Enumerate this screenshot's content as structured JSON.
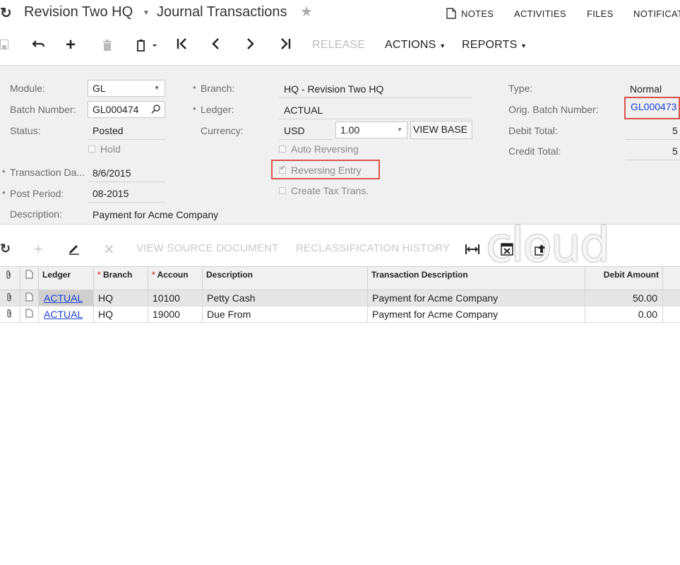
{
  "header": {
    "company": "Revision Two HQ",
    "screen_title": "Journal Transactions",
    "nav": [
      "NOTES",
      "ACTIVITIES",
      "FILES",
      "NOTIFICATIONS"
    ]
  },
  "toolbar": {
    "release": "RELEASE",
    "actions": "ACTIONS",
    "reports": "REPORTS"
  },
  "form": {
    "module_label": "Module:",
    "module_value": "GL",
    "batch_label": "Batch Number:",
    "batch_value": "GL000474",
    "status_label": "Status:",
    "status_value": "Posted",
    "hold_label": "Hold",
    "trans_date_label": "Transaction Da...",
    "trans_date_value": "8/6/2015",
    "post_period_label": "Post Period:",
    "post_period_value": "08-2015",
    "description_label": "Description:",
    "description_value": "Payment for Acme Company",
    "branch_label": "Branch:",
    "branch_value": "HQ - Revision Two HQ",
    "ledger_label": "Ledger:",
    "ledger_value": "ACTUAL",
    "currency_label": "Currency:",
    "currency_value": "USD",
    "rate_value": "1.00",
    "view_base": "VIEW BASE",
    "auto_reversing_label": "Auto Reversing",
    "reversing_entry_label": "Reversing Entry",
    "create_tax_label": "Create Tax Trans.",
    "type_label": "Type:",
    "type_value": "Normal",
    "orig_batch_label": "Orig. Batch Number:",
    "orig_batch_value": "GL000473",
    "debit_total_label": "Debit Total:",
    "debit_total_value": "5",
    "credit_total_label": "Credit Total:",
    "credit_total_value": "5"
  },
  "grid_toolbar": {
    "view_source": "VIEW SOURCE DOCUMENT",
    "reclass_history": "RECLASSIFICATION HISTORY"
  },
  "grid": {
    "columns": [
      "Ledger",
      "Branch",
      "Accoun",
      "Description",
      "Transaction Description",
      "Debit Amount"
    ],
    "rows": [
      {
        "ledger": "ACTUAL",
        "branch": "HQ",
        "account": "10100",
        "description": "Petty Cash",
        "trans_desc": "Payment for Acme Company",
        "debit": "50.00"
      },
      {
        "ledger": "ACTUAL",
        "branch": "HQ",
        "account": "19000",
        "description": "Due From",
        "trans_desc": "Payment for Acme Company",
        "debit": "0.00"
      }
    ]
  },
  "watermark": "cloud"
}
